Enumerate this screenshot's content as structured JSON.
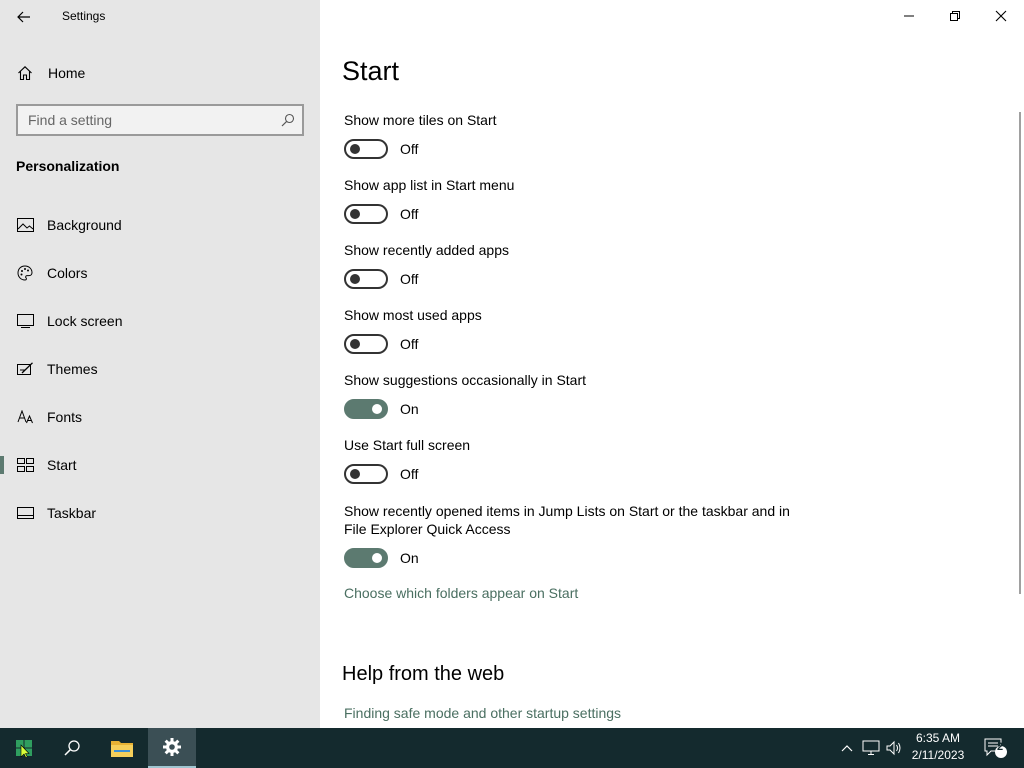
{
  "window": {
    "title": "Settings",
    "controls": {
      "minimize": "minimize",
      "restore": "restore",
      "close": "close"
    }
  },
  "sidebar": {
    "home_label": "Home",
    "search_placeholder": "Find a setting",
    "section_title": "Personalization",
    "items": [
      {
        "label": "Background",
        "icon": "picture-icon"
      },
      {
        "label": "Colors",
        "icon": "palette-icon"
      },
      {
        "label": "Lock screen",
        "icon": "lock-screen-icon"
      },
      {
        "label": "Themes",
        "icon": "themes-brush-icon"
      },
      {
        "label": "Fonts",
        "icon": "fonts-icon"
      },
      {
        "label": "Start",
        "icon": "start-tiles-icon",
        "selected": true
      },
      {
        "label": "Taskbar",
        "icon": "taskbar-icon"
      }
    ]
  },
  "main": {
    "title": "Start",
    "settings": [
      {
        "label": "Show more tiles on Start",
        "state": "Off",
        "on": false
      },
      {
        "label": "Show app list in Start menu",
        "state": "Off",
        "on": false
      },
      {
        "label": "Show recently added apps",
        "state": "Off",
        "on": false
      },
      {
        "label": "Show most used apps",
        "state": "Off",
        "on": false
      },
      {
        "label": "Show suggestions occasionally in Start",
        "state": "On",
        "on": true
      },
      {
        "label": "Use Start full screen",
        "state": "Off",
        "on": false
      },
      {
        "label": "Show recently opened items in Jump Lists on Start or the taskbar and in File Explorer Quick Access",
        "state": "On",
        "on": true
      }
    ],
    "folders_link": "Choose which folders appear on Start",
    "help_title": "Help from the web",
    "help_link": "Finding safe mode and other startup settings"
  },
  "taskbar": {
    "time": "6:35 AM",
    "date": "2/11/2023",
    "notification_count": "2"
  },
  "colors": {
    "accent": "#5c7a70",
    "sidebar_bg": "#e6e6e6",
    "taskbar_bg": "#142a2e",
    "link": "#4a6f61"
  }
}
